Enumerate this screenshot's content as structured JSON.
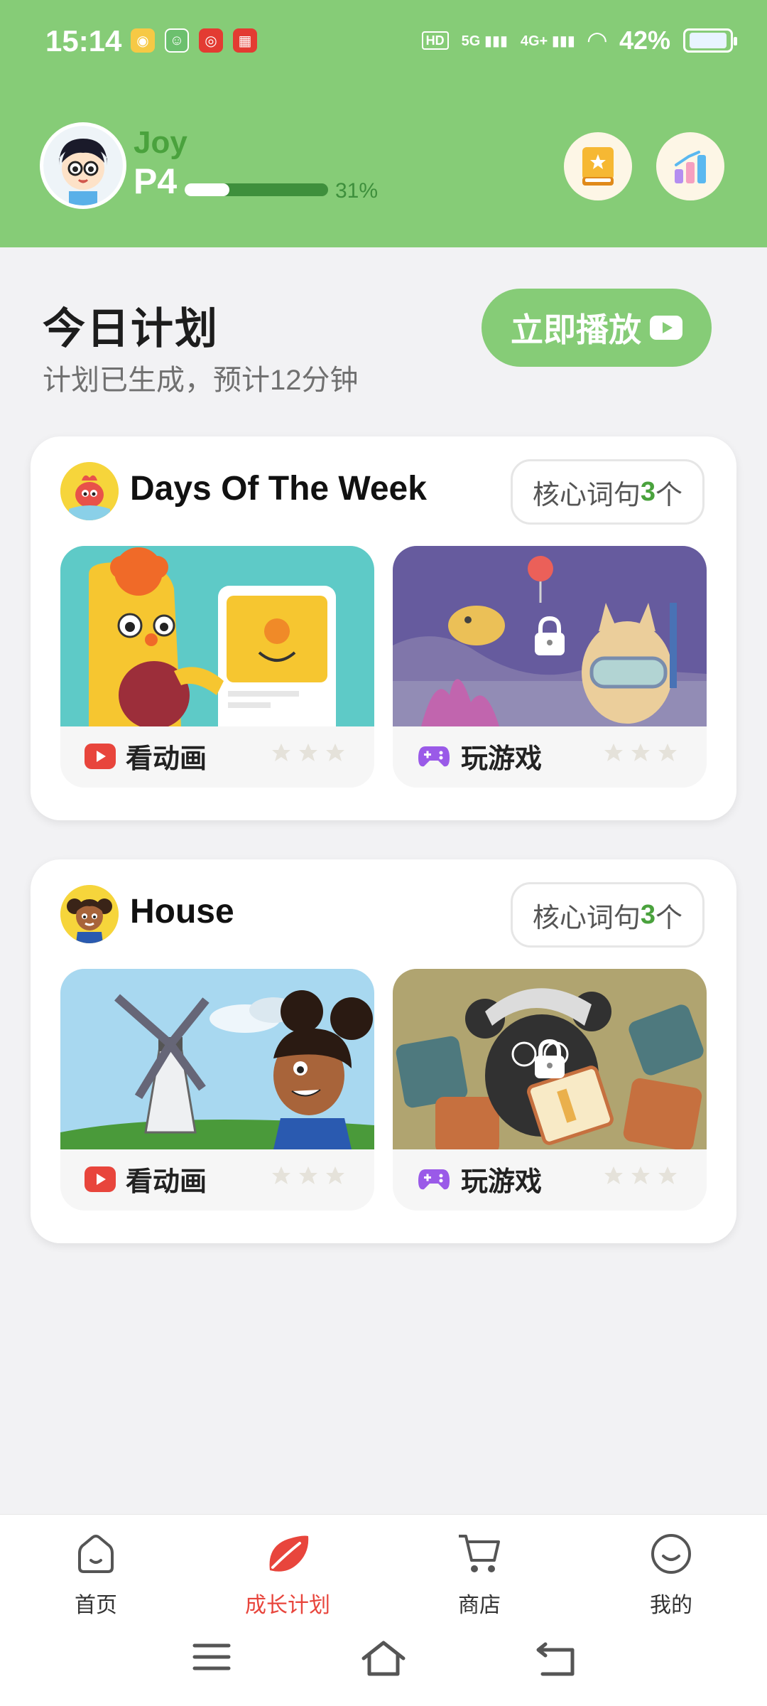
{
  "status_bar": {
    "time": "15:14",
    "battery": "42%",
    "network_labels": [
      "HD",
      "5G",
      "4G+"
    ]
  },
  "profile": {
    "name": "Joy",
    "level": "P4",
    "progress_percent": 31,
    "progress_label": "31%"
  },
  "header_buttons": [
    {
      "icon": "star-book-icon"
    },
    {
      "icon": "bar-chart-icon"
    }
  ],
  "plan": {
    "title": "今日计划",
    "subtitle": "计划已生成，预计12分钟",
    "play_button": "立即播放"
  },
  "lessons": [
    {
      "title": "Days Of The Week",
      "tag_prefix": "核心词句",
      "tag_count": "3",
      "tag_suffix": "个",
      "activities": [
        {
          "label": "看动画",
          "icon": "video-icon",
          "locked": false,
          "stars": 0
        },
        {
          "label": "玩游戏",
          "icon": "gamepad-icon",
          "locked": true,
          "stars": 0
        }
      ]
    },
    {
      "title": "House",
      "tag_prefix": "核心词句",
      "tag_count": "3",
      "tag_suffix": "个",
      "activities": [
        {
          "label": "看动画",
          "icon": "video-icon",
          "locked": false,
          "stars": 0
        },
        {
          "label": "玩游戏",
          "icon": "gamepad-icon",
          "locked": true,
          "stars": 0
        }
      ]
    }
  ],
  "bottom_nav": [
    {
      "label": "首页",
      "icon": "home-icon",
      "active": false
    },
    {
      "label": "成长计划",
      "icon": "leaf-icon",
      "active": true
    },
    {
      "label": "商店",
      "icon": "cart-icon",
      "active": false
    },
    {
      "label": "我的",
      "icon": "smile-icon",
      "active": false
    }
  ],
  "colors": {
    "header_green": "#86cc77",
    "accent_green": "#4aa23d",
    "active_red": "#e8453c"
  }
}
